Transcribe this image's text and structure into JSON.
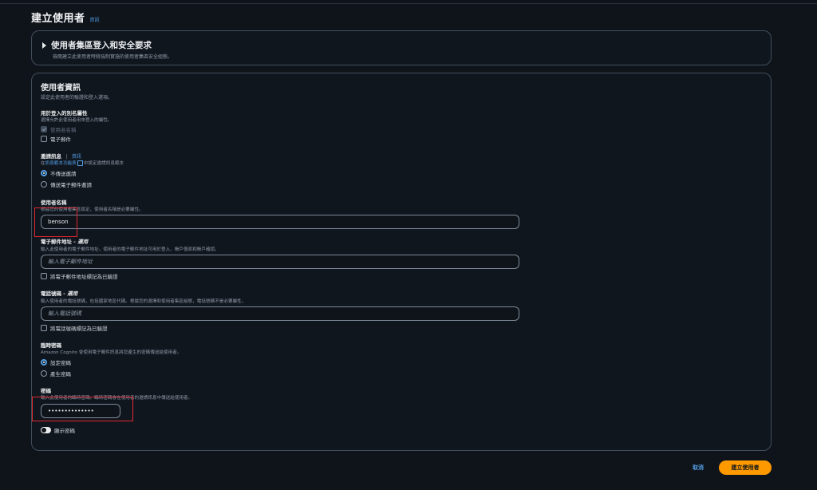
{
  "header": {
    "title": "建立使用者",
    "info": "資訊"
  },
  "requirements": {
    "title": "使用者集區登入和安全要求",
    "desc": "檢閱建立此使用者時將強制實施的使用者集區安全組態。"
  },
  "user_info": {
    "title": "使用者資訊",
    "desc": "設定此使用者的驗證和登入選項。",
    "alias": {
      "label": "用於登入的別名屬性",
      "desc": "選擇允許此使用者用來登入的屬性。",
      "options": [
        "使用者名稱",
        "電子郵件"
      ]
    },
    "invitation": {
      "label": "邀請訊息",
      "info": "資訊",
      "desc_prefix": "在",
      "desc_link": "訊息範本功能表",
      "desc_suffix": "中設定邀請訊息範本",
      "options": [
        "不傳送邀請",
        "傳送電子郵件邀請"
      ]
    },
    "username": {
      "label": "使用者名稱",
      "desc": "根據您的使用者集區設定，使用者名稱是必要屬性。",
      "value": "benson"
    },
    "email": {
      "label": "電子郵件地址",
      "optional": " - 選用",
      "desc": "輸入此使用者的電子郵件地址。使用者的電子郵件地址可用於登入、帳戶復原和帳戶確認。",
      "placeholder": "輸入電子郵件地址",
      "verify_label": "將電子郵件地址標記為已驗證"
    },
    "phone": {
      "label": "電話號碼",
      "optional": " - 選用",
      "desc": "輸入使用者的電話號碼，包括國家地區代碼。根據您的選擇和使用者集區組態，電話號碼不是必要屬性。",
      "placeholder": "輸入電話號碼",
      "verify_label": "將電話號碼標記為已驗證"
    },
    "temp_password": {
      "label": "臨時密碼",
      "desc": "Amazon Cognito 會使用電子郵件訊息將您產生的密碼傳送給使用者。",
      "options": [
        "設定密碼",
        "產生密碼"
      ]
    },
    "password": {
      "label": "密碼",
      "desc": "輸入此使用者的臨時密碼。臨時密碼會在使用者的邀請訊息中傳送給使用者。",
      "value": "••••••••••••••",
      "show_label": "顯示密碼"
    }
  },
  "footer": {
    "cancel": "取消",
    "create": "建立使用者"
  },
  "colors": {
    "accent": "#539fe5",
    "primary": "#ff9900",
    "highlight": "#e0272e"
  }
}
